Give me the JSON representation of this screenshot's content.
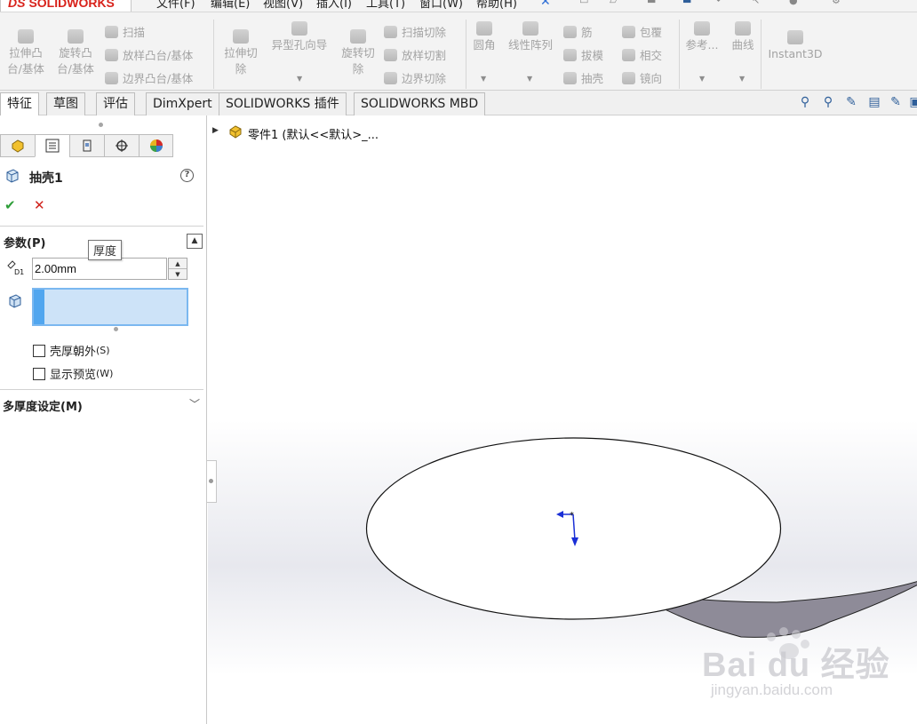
{
  "app": {
    "logo_text": "SOLIDWORKS",
    "logo_mark": "DS"
  },
  "menu": [
    "文件(F)",
    "编辑(E)",
    "视图(V)",
    "插入(I)",
    "工具(T)",
    "窗口(W)",
    "帮助(H)"
  ],
  "commands": {
    "extrude_boss": "拉伸凸台/基体",
    "revolve_boss": "旋转凸台/基体",
    "sweep": "扫描",
    "loft_boss": "放样凸台/基体",
    "boundary_boss": "边界凸台/基体",
    "extrude_cut": "拉伸切除",
    "hole_wizard": "异型孔向导",
    "revolve_cut": "旋转切除",
    "sweep_cut": "扫描切除",
    "loft_cut": "放样切割",
    "boundary_cut": "边界切除",
    "fillet": "圆角",
    "linear_pattern": "线性阵列",
    "rib": "筋",
    "draft": "拔模",
    "shell": "抽壳",
    "wrap": "包覆",
    "intersect": "相交",
    "mirror": "镜向",
    "reference": "参考...",
    "curves": "曲线",
    "instant3d": "Instant3D"
  },
  "tabs": [
    "特征",
    "草图",
    "评估",
    "DimXpert",
    "SOLIDWORKS 插件",
    "SOLIDWORKS MBD"
  ],
  "property_manager": {
    "title": "抽壳1",
    "ok_symbol": "✔",
    "cancel_symbol": "✕",
    "help_symbol": "?",
    "params_title": "参数(P)",
    "tooltip": "厚度",
    "thickness_value": "2.00mm",
    "thickness_icon_label": "D1",
    "shell_outward": "壳厚朝外",
    "shell_outward_accel": "(S)",
    "show_preview": "显示预览",
    "show_preview_accel": "(W)",
    "multi_thickness": "多厚度设定(M)"
  },
  "feature_tree": {
    "root_label": "零件1  (默认<<默认>_..."
  },
  "watermark": {
    "brand": "Bai du 经验",
    "url": "jingyan.baidu.com"
  },
  "colors": {
    "brand_red": "#d8221b",
    "ok_green": "#2e9e39",
    "cancel_red": "#d0231c",
    "selection_blue": "#51a6ef",
    "triad_blue": "#1a2fd6",
    "model_side": "#8e8b98"
  }
}
